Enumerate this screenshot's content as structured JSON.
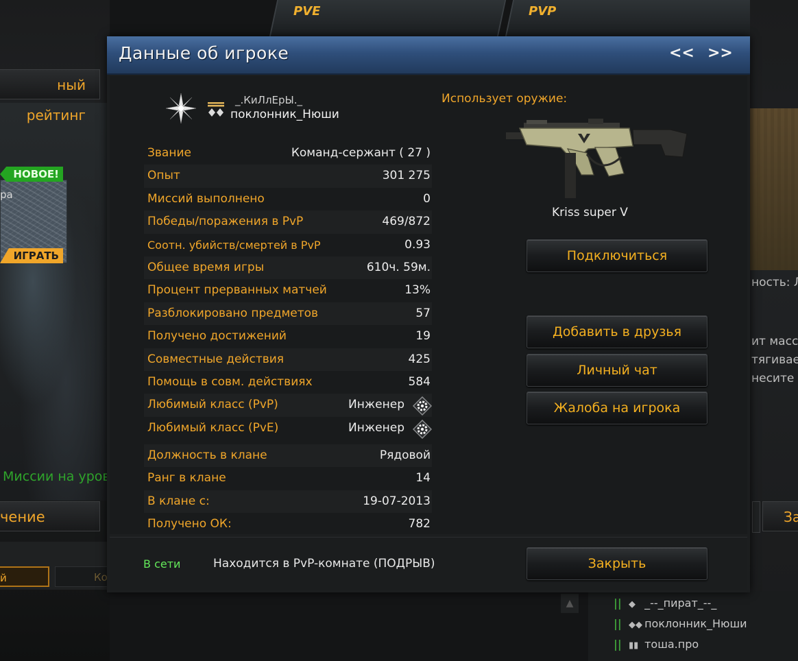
{
  "background": {
    "top_tabs": [
      "PVE",
      "PVP"
    ],
    "rating_button": "ный рейтинг",
    "badge_new": "НОВОЕ!",
    "map_text": "ра",
    "badge_play": "ИГРАТЬ",
    "missions_text": "Миссии на уров",
    "learning_button": "чение",
    "small_btn1": "й",
    "small_btn2": "Ко",
    "right_text": [
      "ность:  Л",
      "ит масс",
      "тягивае",
      "несите"
    ],
    "right_button": "За",
    "friends": [
      {
        "name": "_--_пират_--_"
      },
      {
        "name": "поклонник_Нюши"
      },
      {
        "name": "тоша.про"
      }
    ]
  },
  "dialog": {
    "title": "Данные об игроке",
    "nav_prev": "<<",
    "nav_next": ">>",
    "player": {
      "clan_name": "_.КиЛлЕрЫ._",
      "name": "поклонник_Нюши"
    },
    "stats": [
      {
        "label": "Звание",
        "value": "Команд-сержант ( 27 )"
      },
      {
        "label": "Опыт",
        "value": "301 275"
      },
      {
        "label": "Миссий выполнено",
        "value": "0"
      },
      {
        "label": "Победы/поражения в PvP",
        "value": "469/872"
      },
      {
        "label": "Соотн. убийств/смертей в PvP",
        "value": "0.93"
      },
      {
        "label": "Общее время игры",
        "value": "610ч. 59м."
      },
      {
        "label": "Процент прерванных матчей",
        "value": "13%"
      },
      {
        "label": "Разблокировано предметов",
        "value": "57"
      },
      {
        "label": "Получено достижений",
        "value": "19"
      },
      {
        "label": "Совместные действия",
        "value": "425"
      },
      {
        "label": "Помощь в совм. действиях",
        "value": "584"
      },
      {
        "label": "Любимый класс (PvP)",
        "value": "Инженер"
      },
      {
        "label": "Любимый класс (PvE)",
        "value": "Инженер"
      }
    ],
    "clan_stats": [
      {
        "label": "Должность в клане",
        "value": "Рядовой"
      },
      {
        "label": "Ранг в клане",
        "value": "14"
      },
      {
        "label": "В клане с:",
        "value": "19-07-2013"
      },
      {
        "label": "Получено ОК:",
        "value": "782"
      }
    ],
    "weapon": {
      "title": "Использует оружие:",
      "name": "Kriss super V"
    },
    "buttons": {
      "connect": "Подключиться",
      "add_friend": "Добавить в друзья",
      "private_chat": "Личный чат",
      "report": "Жалоба на игрока",
      "close": "Закрыть"
    },
    "status": {
      "online": "В сети",
      "location": "Находится в PvP-комнате (ПОДРЫВ)"
    }
  },
  "colors": {
    "accent_orange": "#f0a62a",
    "button_text": "#f4b020",
    "header_blue": "#2f4f7b",
    "online_green": "#64e95a"
  }
}
